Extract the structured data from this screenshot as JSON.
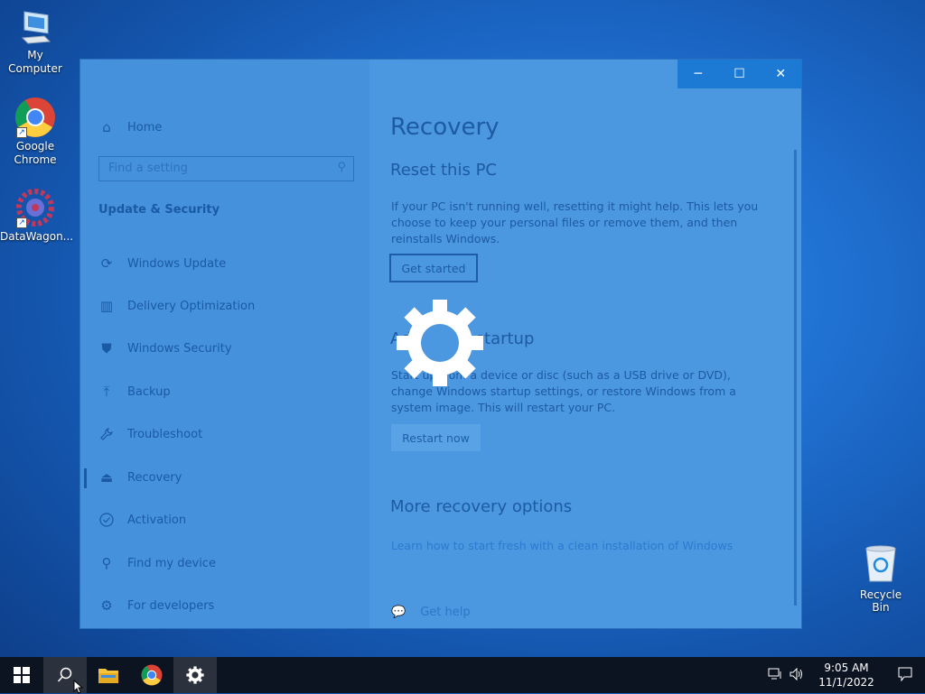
{
  "desktop": {
    "icons": [
      {
        "label": "My Computer",
        "icon": "monitor-icon"
      },
      {
        "label": "Google\nChrome",
        "icon": "chrome-icon"
      },
      {
        "label": "DataWagon...",
        "icon": "datawagon-icon"
      }
    ],
    "recycle_bin": {
      "label": "Recycle Bin",
      "icon": "recycle-bin-icon"
    }
  },
  "window": {
    "controls": {
      "minimize": "─",
      "maximize": "☐",
      "close": "✕"
    },
    "sidebar": {
      "home": "Home",
      "search_placeholder": "Find a setting",
      "section": "Update & Security",
      "items": [
        {
          "label": "Windows Update",
          "icon": "refresh-icon",
          "glyph": "⟳"
        },
        {
          "label": "Delivery Optimization",
          "icon": "delivery-optimization-icon",
          "glyph": "▥"
        },
        {
          "label": "Windows Security",
          "icon": "shield-icon",
          "glyph": "⛊"
        },
        {
          "label": "Backup",
          "icon": "backup-icon",
          "glyph": "⤒"
        },
        {
          "label": "Troubleshoot",
          "icon": "wrench-icon",
          "glyph": "🔧"
        },
        {
          "label": "Recovery",
          "icon": "recovery-icon",
          "glyph": "⏏"
        },
        {
          "label": "Activation",
          "icon": "check-circle-icon",
          "glyph": "✓"
        },
        {
          "label": "Find my device",
          "icon": "person-location-icon",
          "glyph": "⚲"
        },
        {
          "label": "For developers",
          "icon": "developer-icon",
          "glyph": "⚙"
        }
      ],
      "selected": "Recovery"
    },
    "main": {
      "title": "Recovery",
      "reset": {
        "heading": "Reset this PC",
        "description": "If your PC isn't running well, resetting it might help. This lets you choose to keep your personal files or remove them, and then reinstalls Windows.",
        "button": "Get started"
      },
      "advanced": {
        "heading": "Advanced startup",
        "description": "Start up from a device or disc (such as a USB drive or DVD), change Windows startup settings, or restore Windows from a system image. This will restart your PC.",
        "button": "Restart now"
      },
      "more": {
        "heading": "More recovery options",
        "link": "Learn how to start fresh with a clean installation of Windows"
      },
      "help": "Get help"
    },
    "loading_icon": "settings-gear-icon"
  },
  "taskbar": {
    "time": "9:05 AM",
    "date": "11/1/2022",
    "items": [
      "start-icon",
      "search-icon",
      "file-explorer-icon",
      "chrome-icon",
      "settings-icon"
    ]
  }
}
